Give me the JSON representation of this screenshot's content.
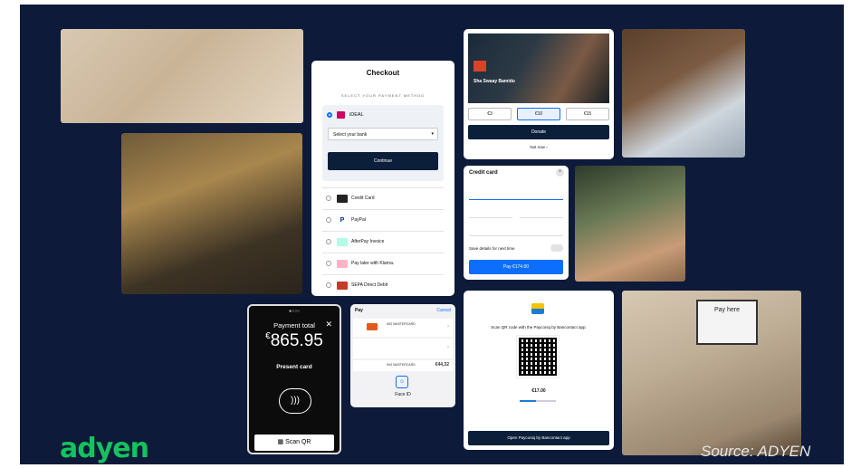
{
  "checkout": {
    "title": "Checkout",
    "subtitle": "SELECT YOUR PAYMENT METHOD",
    "ideal_label": "iDEAL",
    "bank_placeholder": "Select your bank",
    "continue_label": "Continue",
    "methods": [
      "Credit Card",
      "PayPal",
      "AfterPay Invoice",
      "Pay later with Klarna.",
      "SEPA Direct Debit"
    ]
  },
  "donate": {
    "heading": "Sha Swaay Bamidu",
    "amounts": [
      "€3",
      "€10",
      "€15"
    ],
    "donate_label": "Donate",
    "not_now": "Not now ›"
  },
  "credit_card": {
    "title": "Credit card",
    "save_label": "Save details for next time",
    "pay_label": "Pay €174.00"
  },
  "terminal": {
    "status": "●○○○",
    "payment_total": "Payment total",
    "currency": "€",
    "amount": "865.95",
    "present_card": "Present card",
    "scan_qr": "Scan QR"
  },
  "apple_pay": {
    "header": "Pay",
    "cancel": "Cancel",
    "card_name": "ING MASTERCARD",
    "amount": "€44,32",
    "face_id": "Face ID"
  },
  "payconiq": {
    "instruction": "Scan QR code with the Payconiq by Bancontact app.",
    "amount": "€17.00",
    "progress": 0.45,
    "open_label": "Open Payconiq by Bancontact app"
  },
  "kiosk": {
    "screen_text": "Pay here"
  },
  "brand": "adyen",
  "source": "Source: ADYEN",
  "colors": {
    "background": "#0d1a3a",
    "brand_green": "#15c35c",
    "primary_blue": "#0d6efd"
  }
}
